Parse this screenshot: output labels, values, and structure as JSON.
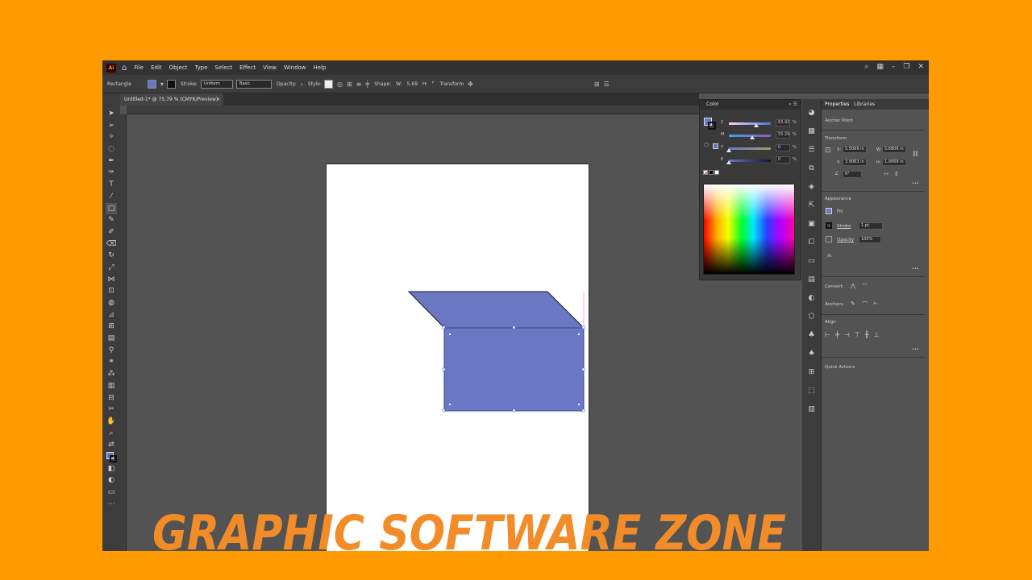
{
  "menu": {
    "logo": "Ai",
    "items": [
      "File",
      "Edit",
      "Object",
      "Type",
      "Select",
      "Effect",
      "View",
      "Window",
      "Help"
    ]
  },
  "control_bar": {
    "tool_name": "Rectangle",
    "stroke_label": "Stroke:",
    "profile": "Uniform",
    "brush": "Basic",
    "opacity_label": "Opacity:",
    "style_label": "Style:",
    "shape_label": "Shape:",
    "width_label": "W:",
    "width_value": "5.69",
    "height_label": "H:",
    "transform_label": "Transform",
    "fill_color": "#6a77c2"
  },
  "document": {
    "tab_title": "Untitled-1* @ 75.79 % (CMYK/Preview)",
    "close": "×"
  },
  "color_panel": {
    "title": "Color",
    "channels": [
      {
        "name": "C",
        "value": "63.92",
        "unit": "%",
        "level": 0.66
      },
      {
        "name": "M",
        "value": "55.29",
        "unit": "%",
        "level": 0.56
      },
      {
        "name": "Y",
        "value": "0",
        "unit": "%",
        "level": 0.0
      },
      {
        "name": "K",
        "value": "0",
        "unit": "%",
        "level": 0.0
      }
    ]
  },
  "properties": {
    "tabs": [
      "Properties",
      "Libraries"
    ],
    "selection": "Anchor Point",
    "transform_title": "Transform",
    "x_label": "X:",
    "x": "5.5069 in",
    "y_label": "Y:",
    "y": "3.9063 in",
    "w_label": "W:",
    "w": "5.6806 in",
    "h_label": "H:",
    "h": "1.0069 in",
    "angle": "0°",
    "appearance_title": "Appearance",
    "fill_label": "Fill",
    "stroke_label": "Stroke",
    "stroke_weight": "1 pt",
    "opacity_label": "Opacity",
    "opacity": "100%",
    "fx": "fx.",
    "convert_label": "Convert:",
    "anchors_label": "Anchors:",
    "align_title": "Align",
    "quick_actions": "Quick Actions",
    "more": "•••"
  },
  "watermark": {
    "text": "GRAPHIC SOFTWARE ZONE",
    "color": "#F28C28"
  },
  "colors": {
    "background": "#FF9A00",
    "shape_fill": "#6a77c2",
    "selection": "#4a6fe8"
  }
}
